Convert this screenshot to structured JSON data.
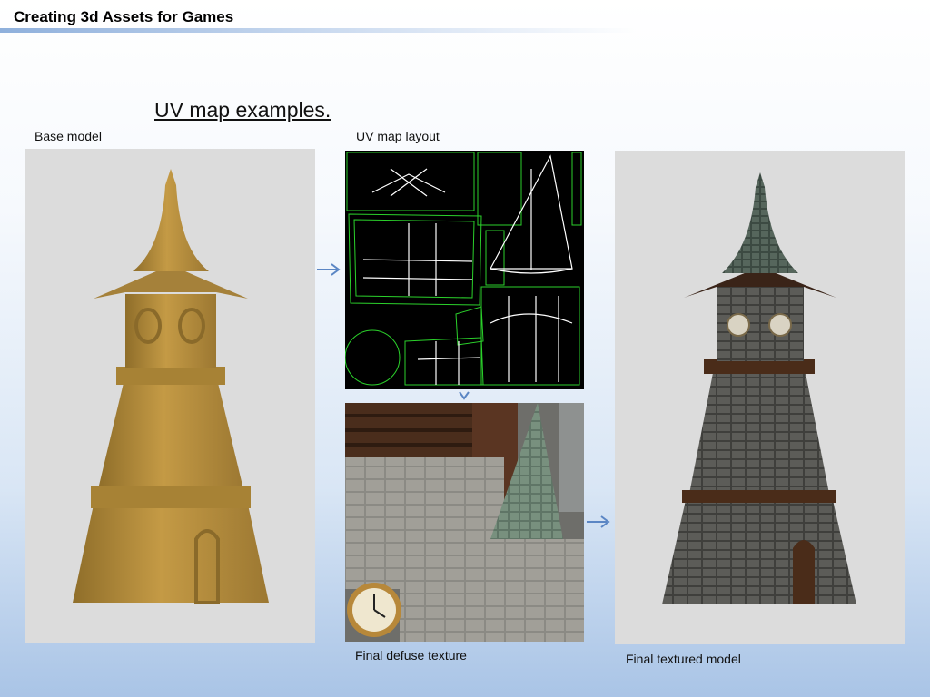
{
  "header": {
    "title": "Creating 3d Assets for Games"
  },
  "slide": {
    "title": "UV map examples.",
    "captions": {
      "base_model": "Base model",
      "uv_layout": "UV map layout",
      "diffuse": "Final defuse texture",
      "textured": "Final textured model"
    }
  },
  "colors": {
    "accent_blue": "#5b86c4",
    "model_tan": "#b8913f",
    "uv_green": "#2bd12b",
    "panel_gray": "#dadada"
  },
  "icons": [
    "arrow-right-icon",
    "arrow-down-icon"
  ]
}
